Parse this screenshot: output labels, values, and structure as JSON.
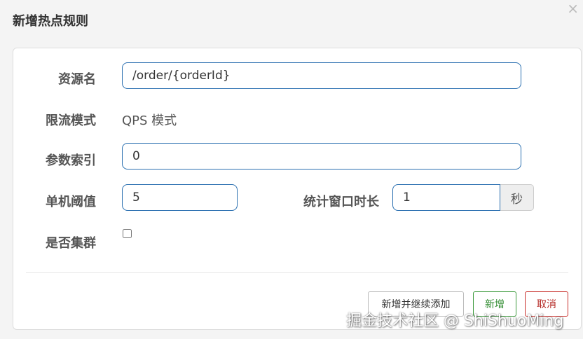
{
  "dialog": {
    "title": "新增热点规则",
    "close_symbol": "×"
  },
  "form": {
    "resource_name": {
      "label": "资源名",
      "value": "/order/{orderId}"
    },
    "flow_mode": {
      "label": "限流模式",
      "value": "QPS 模式"
    },
    "param_index": {
      "label": "参数索引",
      "value": "0"
    },
    "threshold": {
      "label": "单机阈值",
      "value": "5"
    },
    "window": {
      "label": "统计窗口时长",
      "value": "1",
      "unit": "秒"
    },
    "cluster": {
      "label": "是否集群",
      "checked": false
    }
  },
  "buttons": {
    "add_continue": "新增并继续添加",
    "add": "新增",
    "cancel": "取消"
  },
  "watermark": "掘金技术社区 @ ShiShuoMing",
  "colors": {
    "input_border": "#2a6fb0",
    "success": "#2e8b2e",
    "danger": "#b52b27"
  }
}
